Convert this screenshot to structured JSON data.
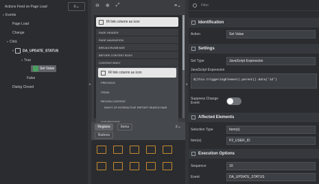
{
  "left": {
    "header": "Actions Fired on Page Load",
    "menu_icon": "≡⌄",
    "tree": {
      "events": "Events",
      "page_load": "Page Load",
      "change": "Change",
      "click": "Click",
      "da_update_status": "DA_UPDATE_STATUS",
      "true_label": "True",
      "set_value": "Set Value",
      "false_label": "False",
      "dialog_closed": "Dialog Closed"
    }
  },
  "middle": {
    "toolbar": {
      "zoom_out": "⊖",
      "zoom_in": "⊕",
      "expand": "⤢",
      "menu": "≡⌄"
    },
    "top_region": "IR link column as icon",
    "slots": [
      "PAGE HEADER",
      "PAGE NAVIGATION",
      "BREADCRUMB BAR",
      "BEFORE CONTENT BODY",
      "CONTENT BODY"
    ],
    "content_region": "IR link column as icon",
    "sub_items": [
      "PREVIOUS",
      "ITEMS",
      "REGION CONTENT",
      "RIGHT OF INTERACTIVE REPORT SEARCH BAR",
      "SUB REGIONS"
    ],
    "gallery_tabs": [
      "Regions",
      "Items",
      "Buttons"
    ],
    "gallery_menu": "≡⌄"
  },
  "right": {
    "filter_placeholder": "Filter",
    "identification": {
      "title": "Identification",
      "action_label": "Action",
      "action_value": "Set Value"
    },
    "settings": {
      "title": "Settings",
      "set_type_label": "Set Type",
      "set_type_value": "JavaScript Expression",
      "js_label": "JavaScript Expression",
      "js_value": "$(this.triggeringElement).parent().data('id')",
      "suppress_label_1": "Suppress Change",
      "suppress_label_2": "Event",
      "suppress_value": false
    },
    "affected": {
      "title": "Affected Elements",
      "selection_type_label": "Selection Type",
      "selection_type_value": "Item(s)",
      "items_label": "Item(s)",
      "items_value": "P2_USER_ID"
    },
    "execution": {
      "title": "Execution Options",
      "sequence_label": "Sequence",
      "sequence_value": "10",
      "event_label": "Event",
      "event_value": "DA_UPDATE_STATUS"
    }
  },
  "colors": {
    "accent_green": "#4aa061",
    "gallery_orange": "#c98a2e"
  }
}
